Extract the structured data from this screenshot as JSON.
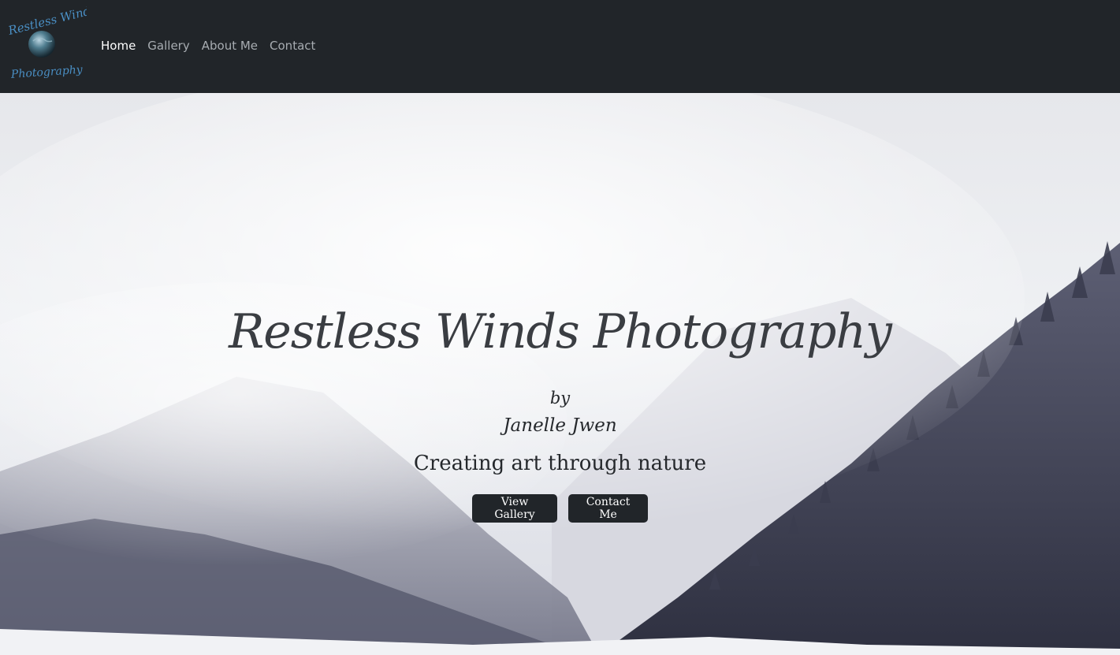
{
  "brand": {
    "logo_text_top": "Restless Winds",
    "logo_text_bottom": "Photography",
    "logo_color": "#4a8fc4"
  },
  "nav": {
    "items": [
      {
        "label": "Home",
        "active": true
      },
      {
        "label": "Gallery",
        "active": false
      },
      {
        "label": "About Me",
        "active": false
      },
      {
        "label": "Contact",
        "active": false
      }
    ],
    "background": "#212529"
  },
  "hero": {
    "title": "Restless Winds Photography",
    "by": "by",
    "author": "Janelle Jwen",
    "tagline": "Creating art through nature",
    "buttons": {
      "view_gallery": "View Gallery",
      "contact_me": "Contact Me"
    },
    "background_image": "snowy-mountain-forest-valley"
  }
}
